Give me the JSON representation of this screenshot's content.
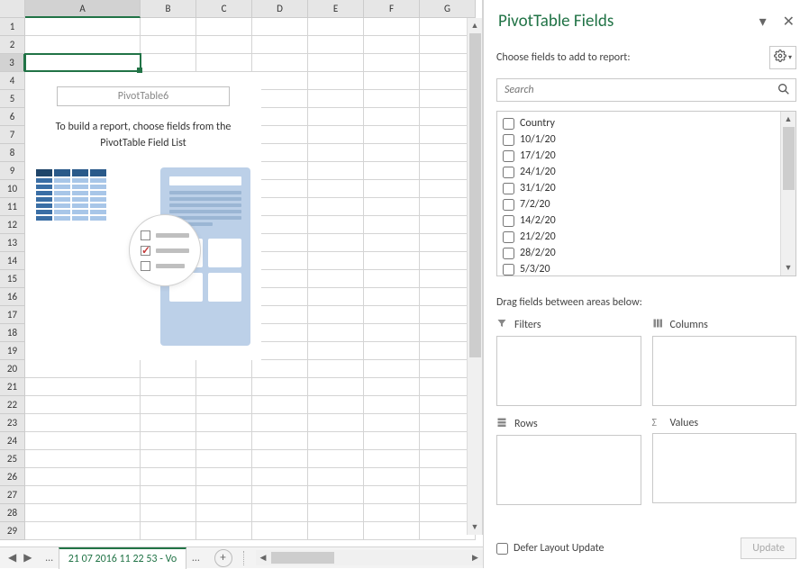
{
  "sheet": {
    "columns": [
      "A",
      "B",
      "C",
      "D",
      "E",
      "F",
      "G"
    ],
    "row_count": 29,
    "active_cell": "A3",
    "pivot_title": "PivotTable6",
    "pivot_message_line1": "To build a report, choose fields from the",
    "pivot_message_line2": "PivotTable Field List",
    "tab_name": "21 07 2016 11 22 53 - Vo"
  },
  "pane": {
    "title": "PivotTable Fields",
    "sublabel": "Choose fields to add to report:",
    "search_placeholder": "Search",
    "fields": [
      "Country",
      "10/1/20",
      "17/1/20",
      "24/1/20",
      "31/1/20",
      "7/2/20",
      "14/2/20",
      "21/2/20",
      "28/2/20",
      "5/3/20"
    ],
    "drag_label": "Drag fields between areas below:",
    "areas": {
      "filters": "Filters",
      "columns": "Columns",
      "rows": "Rows",
      "values": "Values"
    },
    "defer_label": "Defer Layout Update",
    "update_button": "Update"
  }
}
